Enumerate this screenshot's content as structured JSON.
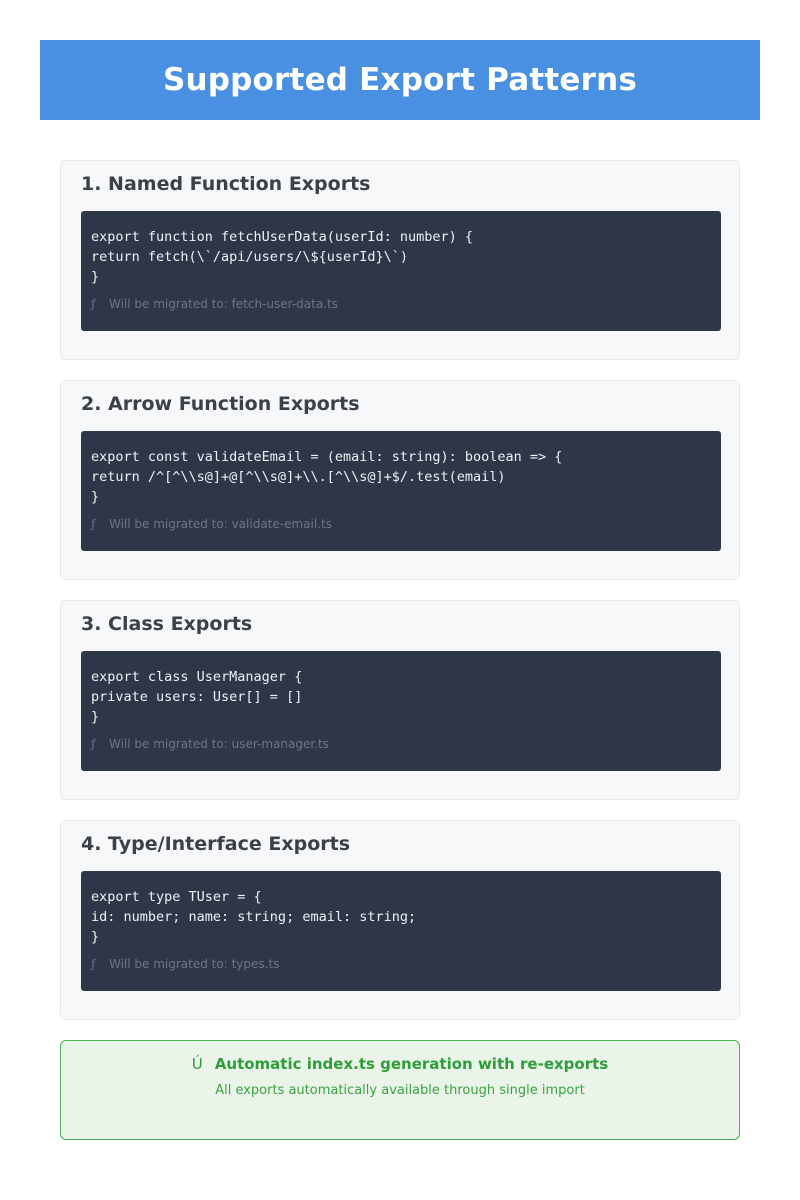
{
  "header": {
    "title": "Supported Export Patterns"
  },
  "sections": [
    {
      "title": "1. Named Function Exports",
      "code": [
        "export function fetchUserData(userId: number) {",
        "return fetch(\\`/api/users/\\${userId}\\`)",
        "}"
      ],
      "note_icon": "ƒ",
      "note": "Will be migrated to: fetch-user-data.ts"
    },
    {
      "title": "2. Arrow Function Exports",
      "code": [
        "export const validateEmail = (email: string): boolean => {",
        "return /^[^\\\\s@]+@[^\\\\s@]+\\\\.[^\\\\s@]+$/.test(email)",
        "}"
      ],
      "note_icon": "ƒ",
      "note": "Will be migrated to: validate-email.ts"
    },
    {
      "title": "3. Class Exports",
      "code": [
        "export class UserManager {",
        "private users: User[] = []",
        "}"
      ],
      "note_icon": "ƒ",
      "note": "Will be migrated to: user-manager.ts"
    },
    {
      "title": "4. Type/Interface Exports",
      "code": [
        "export type TUser = {",
        "id: number; name: string; email: string;",
        "}"
      ],
      "note_icon": "ƒ",
      "note": "Will be migrated to: types.ts"
    }
  ],
  "footer": {
    "icon": "Ú",
    "title": "Automatic index.ts generation with re-exports",
    "subtitle": "All exports automatically available through single import"
  },
  "colors": {
    "header_bg": "#4a90e2",
    "code_bg": "#2e3748",
    "card_bg": "#f7f8fa",
    "success_green": "#2e9e3a",
    "success_bg": "#eaf4e9"
  }
}
